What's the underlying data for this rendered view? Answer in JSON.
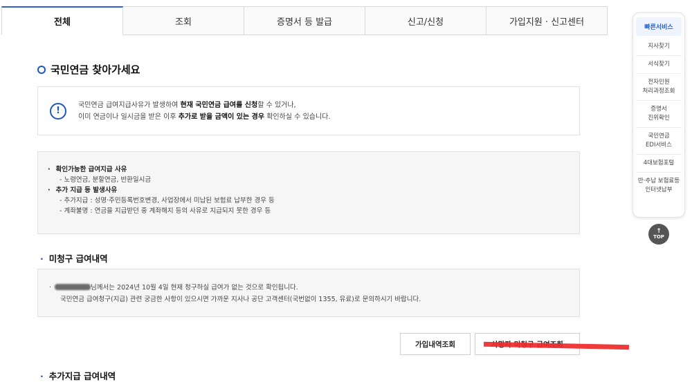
{
  "tabs": [
    {
      "label": "전체",
      "active": true
    },
    {
      "label": "조회",
      "active": false
    },
    {
      "label": "증명서 등 발급",
      "active": false
    },
    {
      "label": "신고/신청",
      "active": false
    },
    {
      "label": "가입지원 · 신고센터",
      "active": false
    }
  ],
  "page_title": "국민연금 찾아가세요",
  "notice": {
    "icon": "info-icon",
    "line1_a": "국민연금 급여지급사유가 발생하여 ",
    "line1_b": "현재 국민연금 급여를 신청",
    "line1_c": "할 수 있거나,",
    "line2_a": "이미 연금이나 일시금을 받은 이후 ",
    "line2_b": "추가로 받을 금액이 있는 경우",
    "line2_c": " 확인하실 수 있습니다."
  },
  "reasons": {
    "h1": "확인가능한 급여지급 사유",
    "h1_sub": "- 노령연금, 분할연금, 반환일시금",
    "h2": "추가 지급 등 발생사유",
    "h2_sub1": "- 추가지급 : 성명·주민등록번호변경, 사업장에서 미납된 보험료 납부한 경우 등",
    "h2_sub2": "- 계좌불명 : 연금을 지급받던 중 계좌해지 등의 사유로 지급되지 못한 경우 등"
  },
  "unclaimed": {
    "title": "미청구 급여내역",
    "line1": "님께서는 2024년 10월 4일 현재 청구하실 급여가 없는 것으로 확인됩니다.",
    "line2": "국민연금 급여청구(지급) 관련 궁금한 사항이 있으시면 가까운 지사나 공단 고객센터(국번없이 1355, 유료)로 문의하시기 바랍니다."
  },
  "buttons": {
    "history": "가입내역조회",
    "deceased": "사망자 미청구 급여조회"
  },
  "next_section": "추가지급 급여내역",
  "quick": {
    "title": "빠른서비스",
    "items": [
      "지사찾기",
      "서식찾기",
      "전자민원\n처리과정조회",
      "증명서\n진위확인",
      "국민연금\nEDI서비스",
      "4대보험포털",
      "반·추납 보험료등\n인터넷납부"
    ]
  },
  "top_label": "TOP",
  "colors": {
    "accent": "#1a56c4",
    "strike": "#ee2a2a"
  }
}
